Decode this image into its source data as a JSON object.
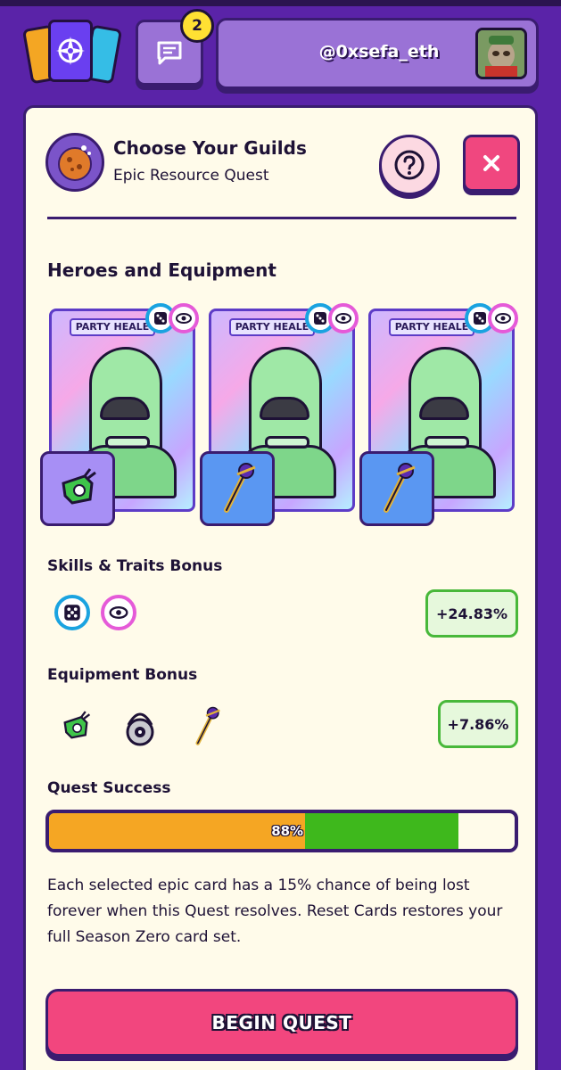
{
  "header": {
    "notification_count": "2",
    "username": "@0xsefa_eth"
  },
  "panel": {
    "title": "Choose Your Guilds",
    "subtitle": "Epic Resource Quest"
  },
  "heroes": {
    "heading": "Heroes and Equipment",
    "cards": [
      {
        "label": "PARTY HEALE",
        "equipment_icon": "whistle-icon"
      },
      {
        "label": "PARTY HEALE",
        "equipment_icon": "staff-icon"
      },
      {
        "label": "PARTY HEALE",
        "equipment_icon": "staff-icon"
      }
    ]
  },
  "skills": {
    "heading": "Skills & Traits Bonus",
    "bonus": "+24.83%",
    "icons": [
      "dice-icon",
      "eye-icon"
    ]
  },
  "equipment": {
    "heading": "Equipment Bonus",
    "bonus": "+7.86%",
    "icons": [
      "whistle-icon",
      "amulet-icon",
      "staff-icon"
    ]
  },
  "quest_success": {
    "heading": "Quest Success",
    "label": "88%",
    "value_percent": 88,
    "segment_orange_fraction": 0.55,
    "segment_green_fraction": 0.88
  },
  "disclaimer": "Each selected epic card has a 15% chance of being lost forever when this Quest resolves. Reset Cards restores your full Season Zero card set.",
  "begin_button": "BEGIN QUEST",
  "colors": {
    "background": "#5a23a8",
    "panel": "#fffbea",
    "accent_pink": "#f2467e",
    "progress_orange": "#f5a623",
    "progress_green": "#3eb81c",
    "bonus_green": "#48b83a"
  }
}
